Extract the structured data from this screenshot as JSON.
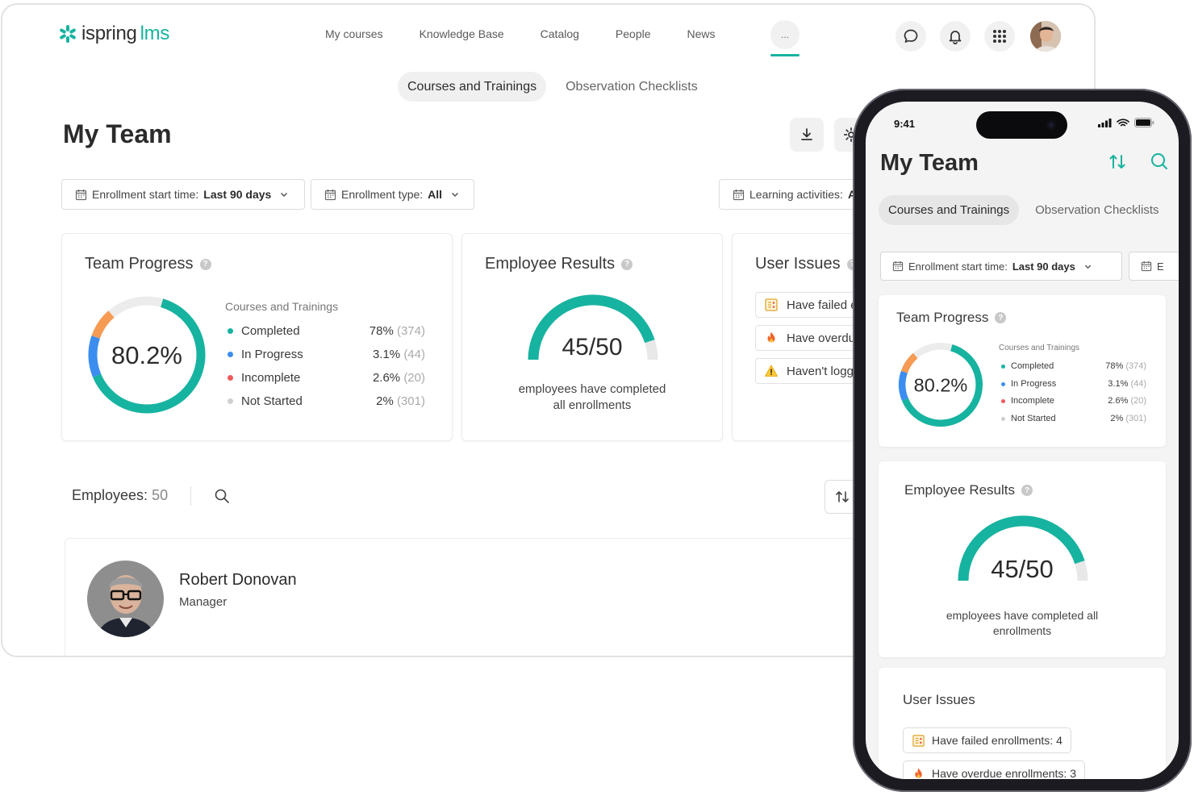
{
  "brand": {
    "word1": "ispring",
    "word2": "lms",
    "accent": "#16b3a0"
  },
  "nav": {
    "items": [
      "My courses",
      "Knowledge Base",
      "Catalog",
      "People",
      "News"
    ],
    "more_label": "..."
  },
  "tabs": {
    "courses": "Courses and Trainings",
    "checklists": "Observation Checklists"
  },
  "page": {
    "title": "My Team"
  },
  "filters": {
    "start": {
      "label": "Enrollment start time:",
      "value": "Last 90 days"
    },
    "type": {
      "label": "Enrollment type:",
      "value": "All"
    },
    "activities": {
      "label": "Learning activities:",
      "value": "A"
    },
    "phone_second_cut": "E"
  },
  "team_progress": {
    "title": "Team Progress",
    "center_label": "80.2%",
    "legend_title": "Courses and Trainings",
    "rows": [
      {
        "label": "Completed",
        "pct": "78%",
        "count": "(374)",
        "color": "#16b3a0"
      },
      {
        "label": "In Progress",
        "pct": "3.1%",
        "count": "(44)",
        "color": "#3b8ef0"
      },
      {
        "label": "Incomplete",
        "pct": "2.6%",
        "count": "(20)",
        "color": "#ef5b5b"
      },
      {
        "label": "Not Started",
        "pct": "2%",
        "count": "(301)",
        "color": "#cfcfcf"
      }
    ],
    "donut_colors": {
      "completed": "#16b3a0",
      "in_progress": "#3b8ef0",
      "incomplete": "#f59b54",
      "not_started": "#ececec"
    }
  },
  "employee_results": {
    "title": "Employee Results",
    "value": "45/50",
    "desktop_caption_1": "employees have completed",
    "desktop_caption_2": "all enrollments",
    "phone_caption_1": "employees have completed all",
    "phone_caption_2": "enrollments",
    "completed": 45,
    "total": 50
  },
  "user_issues": {
    "title": "User Issues",
    "desktop_items": [
      "Have failed e",
      "Have overdu",
      "Haven't logg"
    ],
    "phone_items": [
      "Have failed enrollments:  4",
      "Have overdue enrollments:  3"
    ]
  },
  "employees": {
    "label": "Employees:",
    "count": "50",
    "first": {
      "name": "Robert Donovan",
      "role": "Manager"
    }
  },
  "phone_status": {
    "time": "9:41"
  }
}
